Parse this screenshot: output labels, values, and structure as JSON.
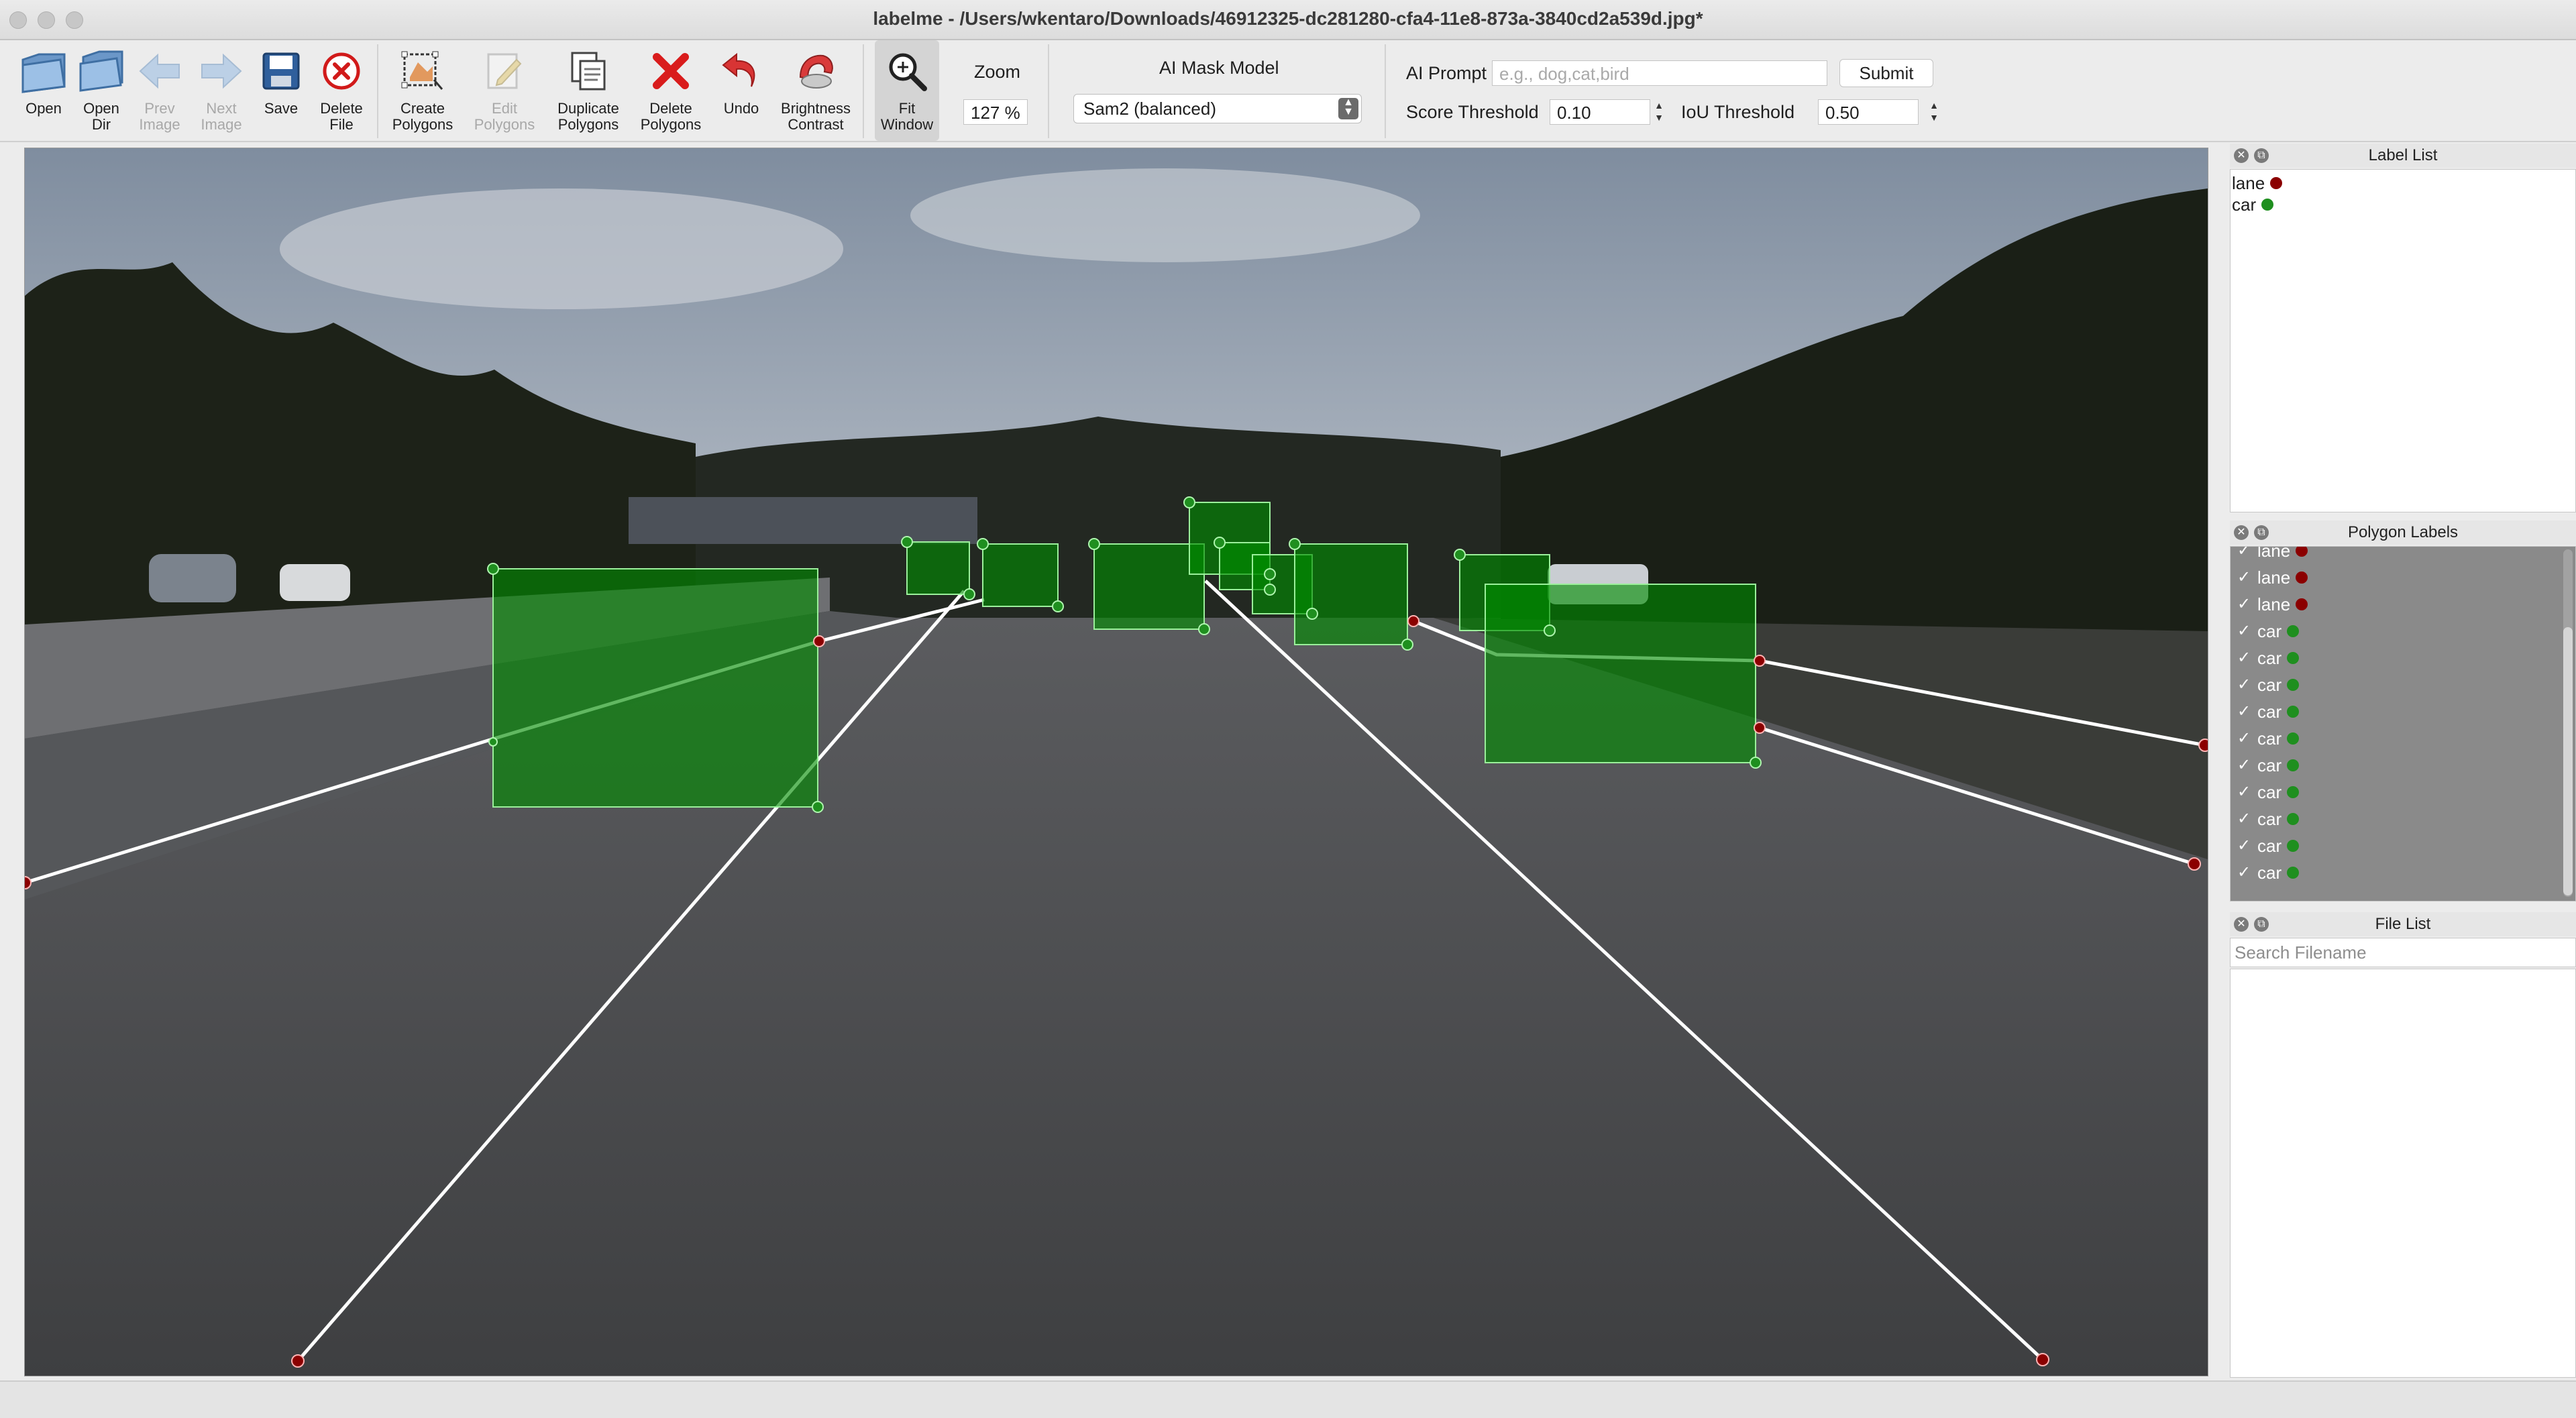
{
  "window": {
    "title": "labelme - /Users/wkentaro/Downloads/46912325-dc281280-cfa4-11e8-873a-3840cd2a539d.jpg*"
  },
  "toolbar": {
    "open": "Open",
    "open_dir": "Open\nDir",
    "prev_image": "Prev\nImage",
    "next_image": "Next\nImage",
    "save": "Save",
    "delete_file": "Delete\nFile",
    "create_polygons": "Create\nPolygons",
    "edit_polygons": "Edit\nPolygons",
    "duplicate_polygons": "Duplicate\nPolygons",
    "delete_polygons": "Delete\nPolygons",
    "undo": "Undo",
    "brightness_contrast": "Brightness\nContrast",
    "fit_window": "Fit\nWindow",
    "zoom_label": "Zoom",
    "zoom_value": "127 %",
    "ai_mask_model_label": "AI Mask Model",
    "ai_mask_model_value": "Sam2 (balanced)",
    "ai_prompt_label": "AI Prompt",
    "ai_prompt_placeholder": "e.g., dog,cat,bird",
    "submit": "Submit",
    "score_threshold_label": "Score Threshold",
    "score_threshold_value": "0.10",
    "iou_threshold_label": "IoU Threshold",
    "iou_threshold_value": "0.50"
  },
  "colors": {
    "lane": "#8b0000",
    "car": "#1f8f1f",
    "box_fill": "rgba(0,140,0,0.55)"
  },
  "label_list": {
    "title": "Label List",
    "items": [
      {
        "label": "lane",
        "color": "#8b0000"
      },
      {
        "label": "car",
        "color": "#1f8f1f"
      }
    ]
  },
  "polygon_labels": {
    "title": "Polygon Labels",
    "items": [
      {
        "label": "lane",
        "color": "#8b0000"
      },
      {
        "label": "lane",
        "color": "#8b0000"
      },
      {
        "label": "lane",
        "color": "#8b0000"
      },
      {
        "label": "car",
        "color": "#1f8f1f"
      },
      {
        "label": "car",
        "color": "#1f8f1f"
      },
      {
        "label": "car",
        "color": "#1f8f1f"
      },
      {
        "label": "car",
        "color": "#1f8f1f"
      },
      {
        "label": "car",
        "color": "#1f8f1f"
      },
      {
        "label": "car",
        "color": "#1f8f1f"
      },
      {
        "label": "car",
        "color": "#1f8f1f"
      },
      {
        "label": "car",
        "color": "#1f8f1f"
      },
      {
        "label": "car",
        "color": "#1f8f1f"
      },
      {
        "label": "car",
        "color": "#1f8f1f"
      }
    ]
  },
  "file_list": {
    "title": "File List",
    "search_placeholder": "Search Filename"
  }
}
